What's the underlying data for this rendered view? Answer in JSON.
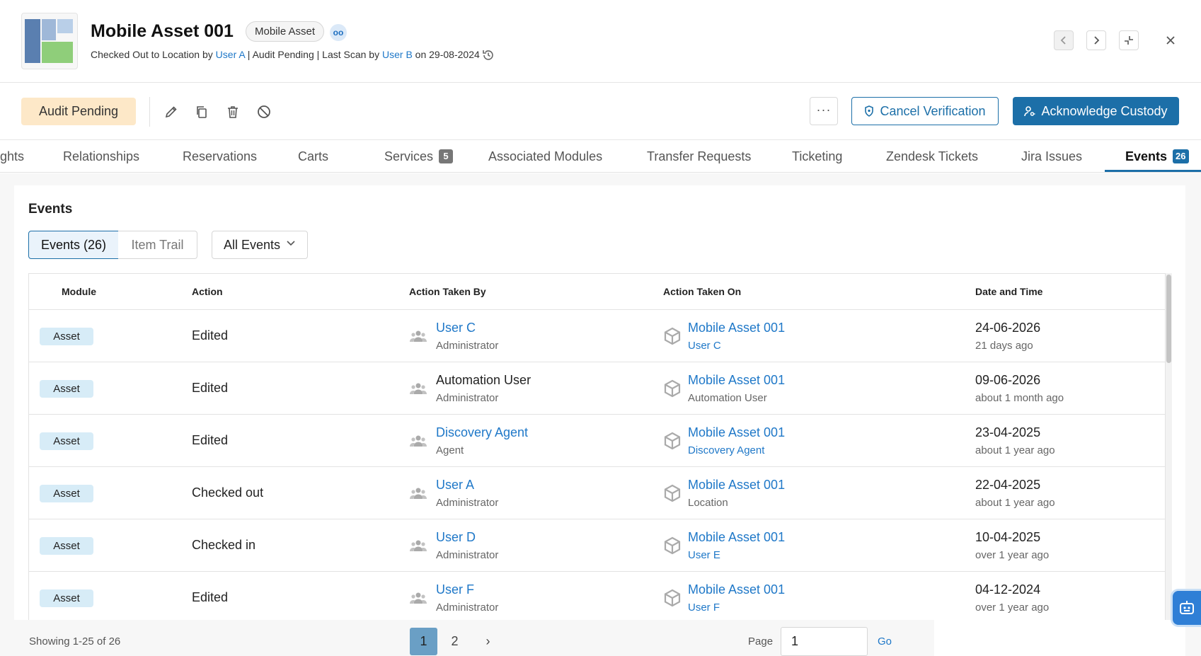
{
  "header": {
    "title": "Mobile Asset 001",
    "type_chip": "Mobile Asset",
    "chip_icon_text": "oo",
    "sub": {
      "p1": "Checked Out to Location by ",
      "user1": "User A",
      "p2": " | Audit Pending | Last Scan by ",
      "user2": "User B",
      "p3": " on 29-08-2024"
    }
  },
  "toolbar": {
    "status": "Audit Pending",
    "more_label": "···",
    "cancel_label": "Cancel Verification",
    "ack_label": "Acknowledge Custody"
  },
  "tabs": [
    {
      "label": "ghts"
    },
    {
      "label": "Relationships"
    },
    {
      "label": "Reservations"
    },
    {
      "label": "Carts"
    },
    {
      "label": "Services",
      "count": "5"
    },
    {
      "label": "Associated Modules"
    },
    {
      "label": "Transfer Requests"
    },
    {
      "label": "Ticketing"
    },
    {
      "label": "Zendesk Tickets"
    },
    {
      "label": "Jira Issues"
    },
    {
      "label": "Events",
      "count": "26"
    }
  ],
  "events": {
    "title": "Events",
    "seg_events": "Events (26)",
    "seg_trail": "Item Trail",
    "filter": "All Events",
    "columns": [
      "Module",
      "Action",
      "Action Taken By",
      "Action Taken On",
      "Date and Time"
    ],
    "rows": [
      {
        "module": "Asset",
        "action": "Edited",
        "by": "User C",
        "role": "Administrator",
        "on": "Mobile Asset 001",
        "on_sub": "User C",
        "date": "24-06-2026",
        "rel": "21 days ago"
      },
      {
        "module": "Asset",
        "action": "Edited",
        "by": "Automation User",
        "role": "Administrator",
        "on": "Mobile Asset 001",
        "on_sub": "Automation User",
        "date": "09-06-2026",
        "rel": "about 1 month ago"
      },
      {
        "module": "Asset",
        "action": "Edited",
        "by": "Discovery Agent",
        "role": "Agent",
        "on": "Mobile Asset 001",
        "on_sub": "Discovery Agent",
        "date": "23-04-2025",
        "rel": "about 1 year ago"
      },
      {
        "module": "Asset",
        "action": "Checked out",
        "by": "User A",
        "role": "Administrator",
        "on": "Mobile Asset 001",
        "on_sub": "Location",
        "date": "22-04-2025",
        "rel": "about 1 year ago"
      },
      {
        "module": "Asset",
        "action": "Checked in",
        "by": "User D",
        "role": "Administrator",
        "on": "Mobile Asset 001",
        "on_sub": "User E",
        "date": "10-04-2025",
        "rel": "over 1 year ago"
      },
      {
        "module": "Asset",
        "action": "Edited",
        "by": "User F",
        "role": "Administrator",
        "on": "Mobile Asset 001",
        "on_sub": "User F",
        "date": "04-12-2024",
        "rel": "over 1 year ago"
      }
    ]
  },
  "pagination": {
    "showing": "Showing 1-25 of 26",
    "pages": [
      "1",
      "2"
    ],
    "next": "›",
    "page_label": "Page",
    "page_value": "1",
    "go": "Go"
  },
  "colors": {
    "primary": "#1c6fa8",
    "link": "#1f78c8",
    "status_bg": "#fde8c8",
    "badge_bg": "#d7ecf7"
  },
  "icons": [
    "history-icon",
    "chevron-left-icon",
    "chevron-right-icon",
    "minimize-icon",
    "close-icon",
    "pencil-icon",
    "copy-icon",
    "trash-icon",
    "block-icon",
    "shield-icon",
    "user-key-icon",
    "users-icon",
    "cube-icon",
    "chevron-down-icon",
    "robot-icon"
  ]
}
